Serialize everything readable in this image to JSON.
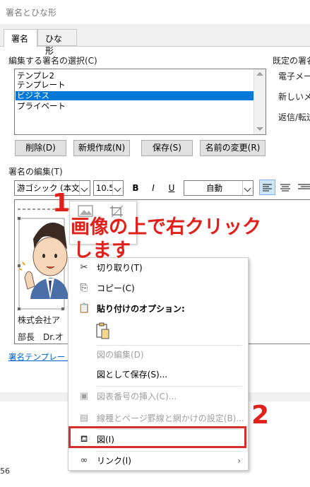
{
  "window": {
    "title": "署名とひな形"
  },
  "tabs": [
    {
      "label": "署名",
      "active": true
    },
    {
      "label": "ひな形",
      "active": false
    }
  ],
  "signature_select": {
    "label": "編集する署名の選択(C)",
    "items": [
      "テンプレ2",
      "テンプレート",
      "ビジネス",
      "プライベート"
    ],
    "selected_index": 2
  },
  "defaults": {
    "label": "既定の署名",
    "email_label": "電子メール",
    "new_label": "新しいメッ",
    "reply_label": "返信/転送"
  },
  "buttons": {
    "delete": "削除(D)",
    "new": "新規作成(N)",
    "save": "保存(S)",
    "rename": "名前の変更(R)"
  },
  "editor": {
    "label": "署名の編集(T)",
    "font": "游ゴシック (本文の",
    "size": "10.5",
    "bold": "B",
    "italic": "I",
    "underline": "U",
    "color": "自動",
    "line1": "株式会社ア",
    "line2": "部長　Dr.オ"
  },
  "template_link": "署名テンプレートを",
  "context_menu": {
    "cut": "切り取り(T)",
    "copy": "コピー(C)",
    "paste_options": "貼り付けのオプション:",
    "edit_picture": "図の編集(D)",
    "save_as_picture": "図として保存(S)...",
    "insert_caption": "図表番号の挿入(C)...",
    "borders": "線種とページ罫線と網かけの設定(B)...",
    "picture": "図(I)",
    "link": "リンク(I)"
  },
  "annotations": {
    "step1_number": "1",
    "step1_text_line1": "画像の上で右クリック",
    "step1_text_line2": "します",
    "step2_number": "2",
    "color": "#e0201b"
  },
  "background_fragments": {
    "number": "56"
  },
  "colors": {
    "selection": "#0078d7",
    "highlight_box": "#d32f2f"
  }
}
